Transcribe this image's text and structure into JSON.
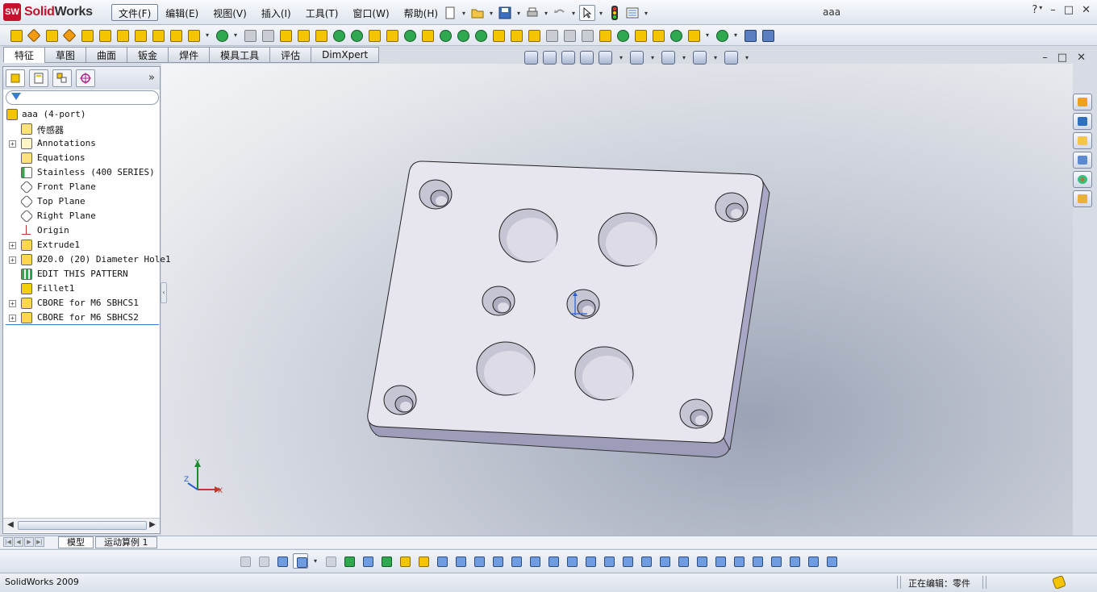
{
  "app": {
    "brand_prefix": "Solid",
    "brand_suffix": "Works",
    "logo_text": "SW",
    "document_title": "aaa"
  },
  "menu": {
    "items": [
      "文件(F)",
      "编辑(E)",
      "视图(V)",
      "插入(I)",
      "工具(T)",
      "窗口(W)",
      "帮助(H)"
    ]
  },
  "window_controls": {
    "help": "?",
    "minimize": "–",
    "restore": "□",
    "close": "✕"
  },
  "command_tabs": [
    "特征",
    "草图",
    "曲面",
    "钣金",
    "焊件",
    "模具工具",
    "评估",
    "DimXpert"
  ],
  "feature_manager": {
    "expand": "»",
    "tree": [
      {
        "label": "aaa  (4-port)",
        "icon": "part-icon",
        "expandable": false,
        "root": true
      },
      {
        "label": "传感器",
        "icon": "sensor-icon",
        "expandable": false
      },
      {
        "label": "Annotations",
        "icon": "annotations-icon",
        "expandable": true
      },
      {
        "label": "Equations",
        "icon": "equations-icon",
        "expandable": false
      },
      {
        "label": "Stainless (400 SERIES)",
        "icon": "material-icon",
        "expandable": false
      },
      {
        "label": "Front Plane",
        "icon": "plane-icon",
        "expandable": false
      },
      {
        "label": "Top Plane",
        "icon": "plane-icon",
        "expandable": false
      },
      {
        "label": "Right Plane",
        "icon": "plane-icon",
        "expandable": false
      },
      {
        "label": "Origin",
        "icon": "origin-icon",
        "expandable": false
      },
      {
        "label": "Extrude1",
        "icon": "extrude-icon",
        "expandable": true
      },
      {
        "label": "Ø20.0 (20) Diameter Hole1",
        "icon": "hole-icon",
        "expandable": true
      },
      {
        "label": "EDIT THIS PATTERN",
        "icon": "pattern-icon",
        "expandable": false
      },
      {
        "label": "Fillet1",
        "icon": "fillet-icon",
        "expandable": false
      },
      {
        "label": "CBORE for M6 SBHCS1",
        "icon": "hole-icon",
        "expandable": true
      },
      {
        "label": "CBORE for M6 SBHCS2",
        "icon": "hole-icon",
        "expandable": true
      }
    ]
  },
  "bottom_tabs": [
    "模型",
    "运动算例 1"
  ],
  "status": {
    "app_version": "SolidWorks 2009",
    "editing": "正在编辑：零件"
  },
  "triad": {
    "x": "X",
    "y": "Y",
    "z": "Z"
  }
}
